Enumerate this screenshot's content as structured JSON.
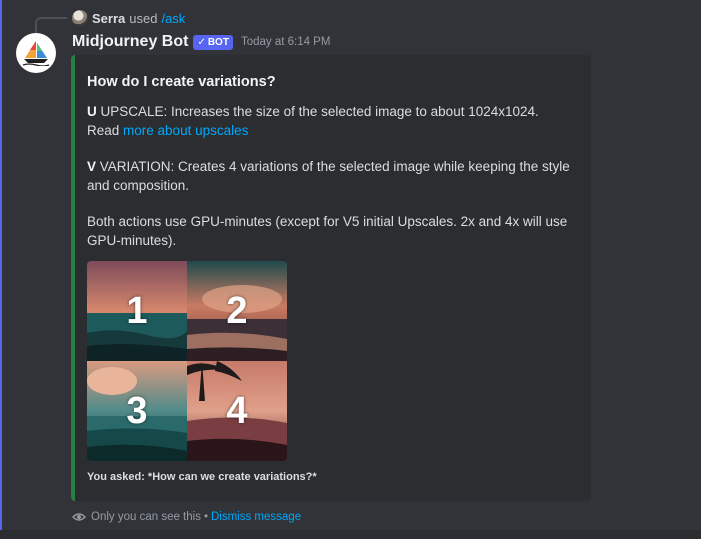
{
  "reply": {
    "user": "Serra",
    "used": "used",
    "command": "/ask"
  },
  "message": {
    "author": "Midjourney Bot",
    "bot_tag": "BOT",
    "timestamp": "Today at 6:14 PM"
  },
  "embed": {
    "accent_color": "#248046",
    "title": "How do I create variations?",
    "upscale_key": "U",
    "upscale_text": " UPSCALE: Increases the size of the selected image to about 1024x1024. Read ",
    "upscale_link": "more about upscales",
    "variation_key": "V",
    "variation_text": " VARIATION: Creates 4 variations of the selected image while keeping the style and composition.",
    "gpu_text": "Both actions use GPU-minutes (except for V5 initial Upscales. 2x and 4x will use GPU-minutes).",
    "image_tiles": [
      "1",
      "2",
      "3",
      "4"
    ],
    "footer": "You asked: *How can we create variations?*"
  },
  "ephemeral": {
    "icon": "eye-icon",
    "text": "Only you can see this",
    "separator": "•",
    "dismiss": "Dismiss message"
  }
}
